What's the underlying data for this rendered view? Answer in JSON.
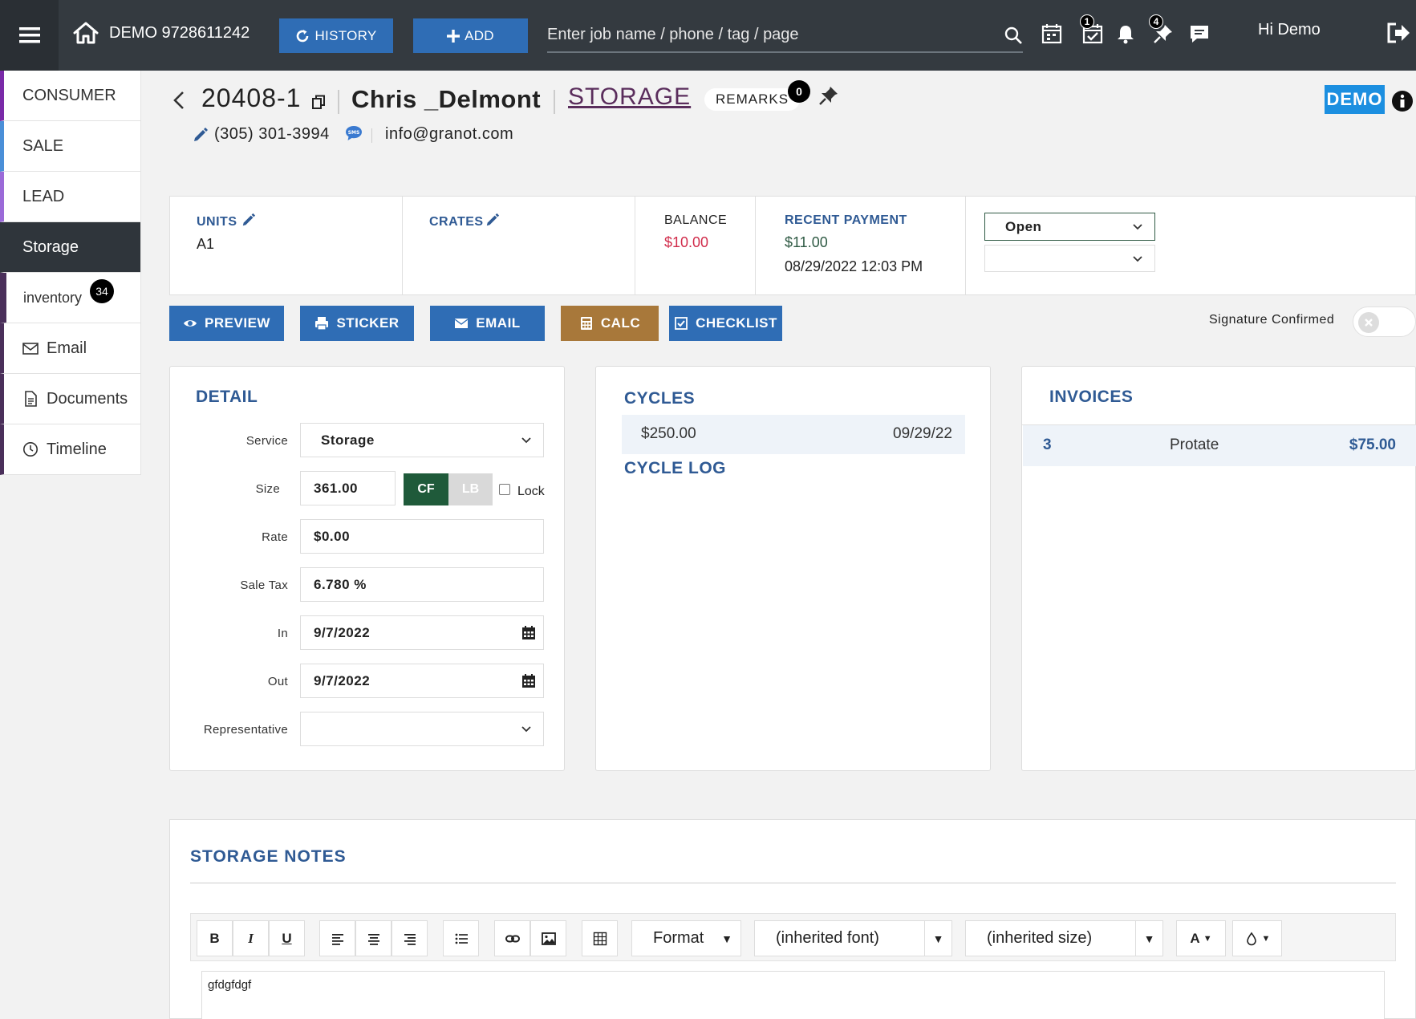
{
  "topbar": {
    "brand": "DEMO 9728611242",
    "history_label": "HISTORY",
    "add_label": "ADD",
    "search_placeholder": "Enter job name / phone / tag / page",
    "tasks_badge": "1",
    "pins_badge": "4",
    "greeting": "Hi Demo"
  },
  "sidebar": {
    "items": [
      {
        "label": "CONSUMER"
      },
      {
        "label": "SALE"
      },
      {
        "label": "LEAD"
      },
      {
        "label": "Storage"
      },
      {
        "label": "inventory",
        "badge": "34"
      },
      {
        "label": "Email"
      },
      {
        "label": "Documents"
      },
      {
        "label": "Timeline"
      }
    ]
  },
  "header": {
    "job_number": "20408-1",
    "customer_name": "Chris _Delmont",
    "status": "STORAGE",
    "remarks_label": "REMARKS",
    "remarks_count": "0",
    "demo_tag": "DEMO",
    "phone": "(305) 301-3994",
    "email": "info@granot.com"
  },
  "summary": {
    "units_label": "UNITS",
    "units_value": "A1",
    "crates_label": "CRATES",
    "balance_label": "BALANCE",
    "balance_value": "$10.00",
    "recent_payment_label": "RECENT PAYMENT",
    "recent_payment_amount": "$11.00",
    "recent_payment_date": "08/29/2022 12:03 PM",
    "status_select": "Open"
  },
  "actions": {
    "preview": "PREVIEW",
    "sticker": "STICKER",
    "email": "EMAIL",
    "calc": "CALC",
    "checklist": "CHECKLIST",
    "signature_label": "Signature Confirmed"
  },
  "detail": {
    "title": "DETAIL",
    "service_label": "Service",
    "service_value": "Storage",
    "size_label": "Size",
    "size_value": "361.00",
    "cf_label": "CF",
    "lb_label": "LB",
    "lock_label": "Lock",
    "rate_label": "Rate",
    "rate_value": "$0.00",
    "tax_label": "Sale Tax",
    "tax_value": "6.780 %",
    "in_label": "In",
    "in_value": "9/7/2022",
    "out_label": "Out",
    "out_value": "9/7/2022",
    "rep_label": "Representative"
  },
  "cycles": {
    "title": "CYCLES",
    "rows": [
      {
        "amount": "$250.00",
        "date": "09/29/22"
      }
    ],
    "log_title": "CYCLE LOG"
  },
  "invoices": {
    "title": "INVOICES",
    "rows": [
      {
        "number": "3",
        "type": "Protate",
        "amount": "$75.00"
      }
    ]
  },
  "notes": {
    "title": "STORAGE NOTES",
    "toolbar": {
      "bold": "B",
      "italic": "I",
      "underline": "U",
      "format": "Format",
      "font": "(inherited font)",
      "size": "(inherited size)",
      "font_color": "A"
    },
    "content": "gfdgfdgf"
  },
  "colors": {
    "topbar": "#343a40",
    "primary_button": "#2f6db5",
    "calc_button": "#a8783a",
    "heading_blue": "#2f5a94",
    "status_purple": "#5a2d5c",
    "balance_red": "#d12c4b",
    "demo_blue": "#1c8fe0"
  }
}
